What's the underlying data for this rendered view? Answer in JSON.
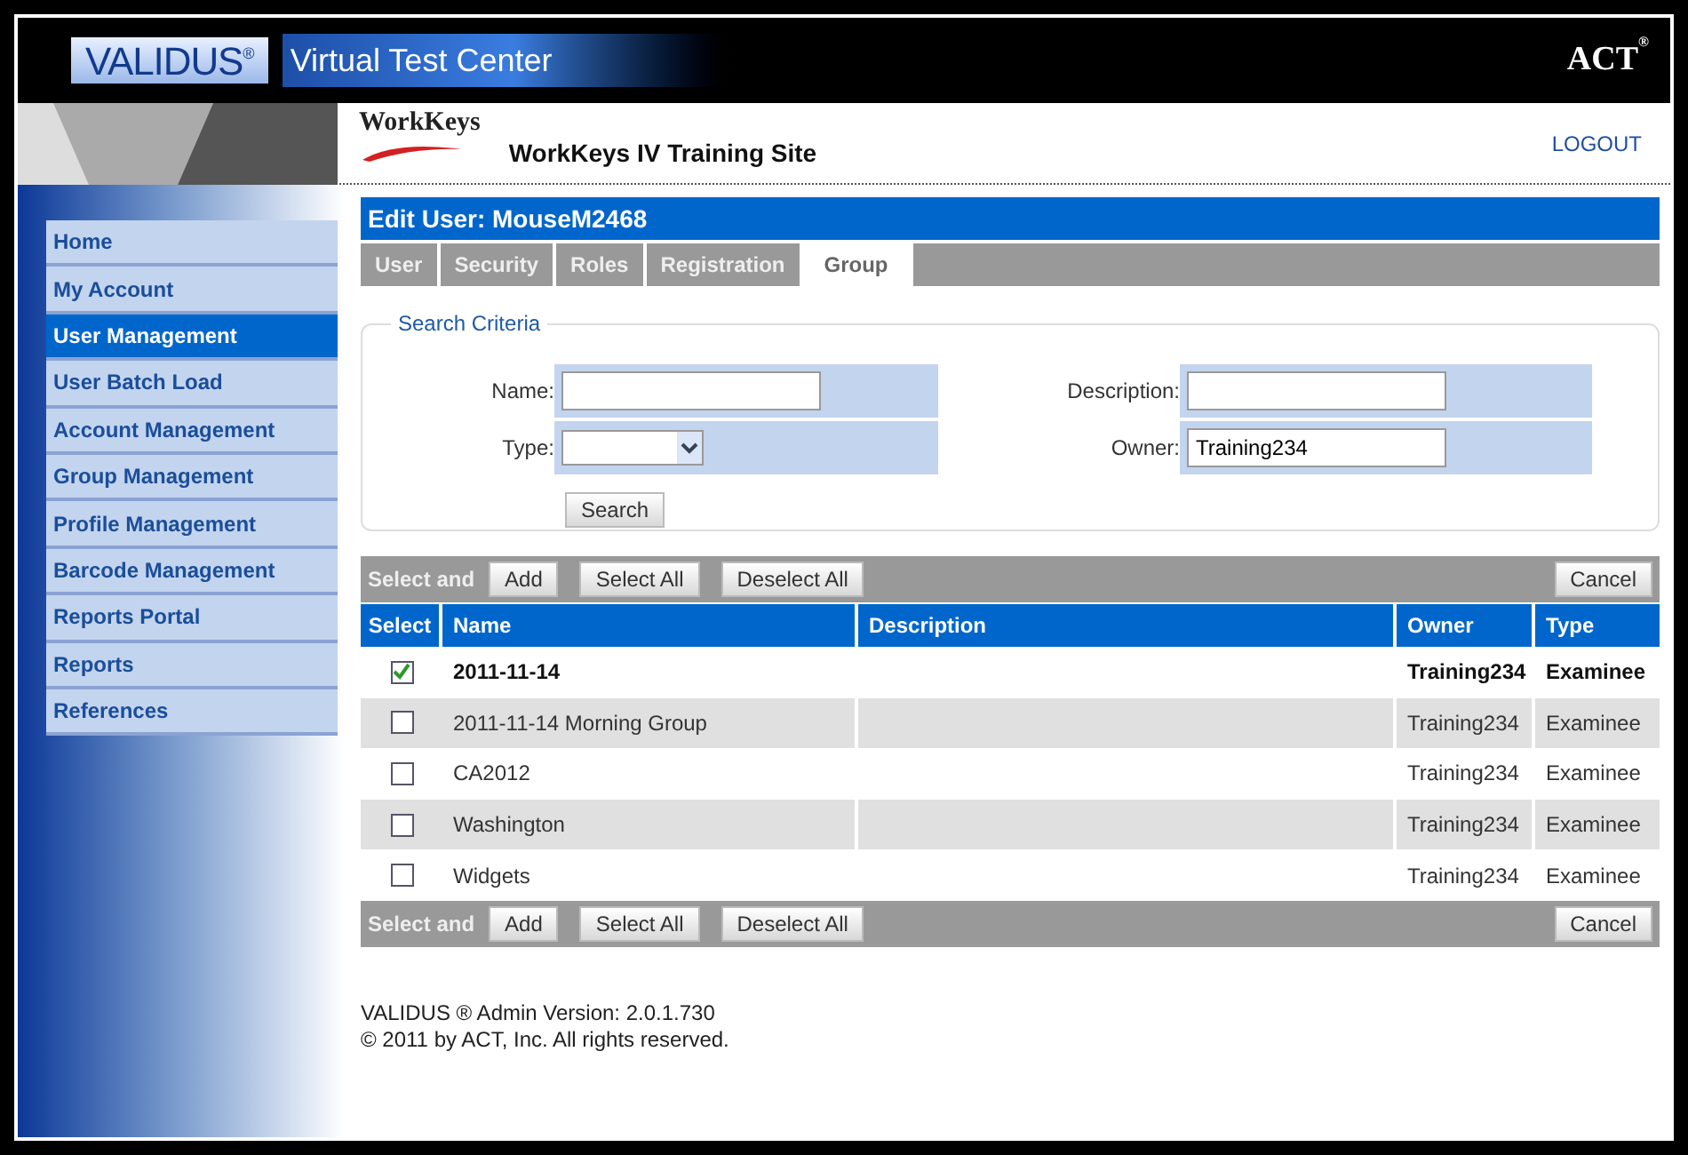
{
  "header": {
    "brand": "VALIDUS",
    "brand_mark": "®",
    "product": "Virtual Test Center",
    "act_logo": "ACT",
    "act_mark": "®"
  },
  "subheader": {
    "logo": "WorkKeys",
    "title": "WorkKeys IV Training Site",
    "logout": "LOGOUT"
  },
  "sidebar": {
    "items": [
      {
        "label": "Home",
        "selected": false
      },
      {
        "label": "My Account",
        "selected": false
      },
      {
        "label": "User Management",
        "selected": true
      },
      {
        "label": "User Batch Load",
        "selected": false
      },
      {
        "label": "Account Management",
        "selected": false
      },
      {
        "label": "Group Management",
        "selected": false
      },
      {
        "label": "Profile Management",
        "selected": false
      },
      {
        "label": "Barcode Management",
        "selected": false
      },
      {
        "label": "Reports Portal",
        "selected": false
      },
      {
        "label": "Reports",
        "selected": false
      },
      {
        "label": "References",
        "selected": false
      }
    ]
  },
  "page_title": "Edit User: MouseM2468",
  "tabs": [
    {
      "label": "User",
      "selected": false
    },
    {
      "label": "Security",
      "selected": false
    },
    {
      "label": "Roles",
      "selected": false
    },
    {
      "label": "Registration",
      "selected": false
    },
    {
      "label": "Group",
      "selected": true
    }
  ],
  "search": {
    "legend": "Search Criteria",
    "name_label": "Name:",
    "description_label": "Description:",
    "type_label": "Type:",
    "owner_label": "Owner:",
    "owner_value": "Training234",
    "button": "Search"
  },
  "top_actions": {
    "label": "Select and",
    "add": "Add",
    "select_all": "Select All",
    "deselect_all": "Deselect All",
    "cancel": "Cancel"
  },
  "table": {
    "columns": [
      "Select",
      "Name",
      "Description",
      "Owner",
      "Type"
    ],
    "rows": [
      {
        "name": "2011-11-14",
        "owner": "Training234",
        "type": "Examinee",
        "checked": true
      },
      {
        "name": "2011-11-14 Morning Group",
        "owner": "Training234",
        "type": "Examinee",
        "checked": false
      },
      {
        "name": "CA2012",
        "owner": "Training234",
        "type": "Examinee",
        "checked": false
      },
      {
        "name": "Washington",
        "owner": "Training234",
        "type": "Examinee",
        "checked": false
      },
      {
        "name": "Widgets",
        "owner": "Training234",
        "type": "Examinee",
        "checked": false
      }
    ]
  },
  "bottom_actions": {
    "label": "Select and",
    "add": "Add",
    "select_all": "Select All",
    "deselect_all": "Deselect All",
    "cancel": "Cancel"
  },
  "footer": {
    "version": "VALIDUS ® Admin Version: 2.0.1.730",
    "copyright": "© 2011 by ACT, Inc. All rights reserved."
  }
}
